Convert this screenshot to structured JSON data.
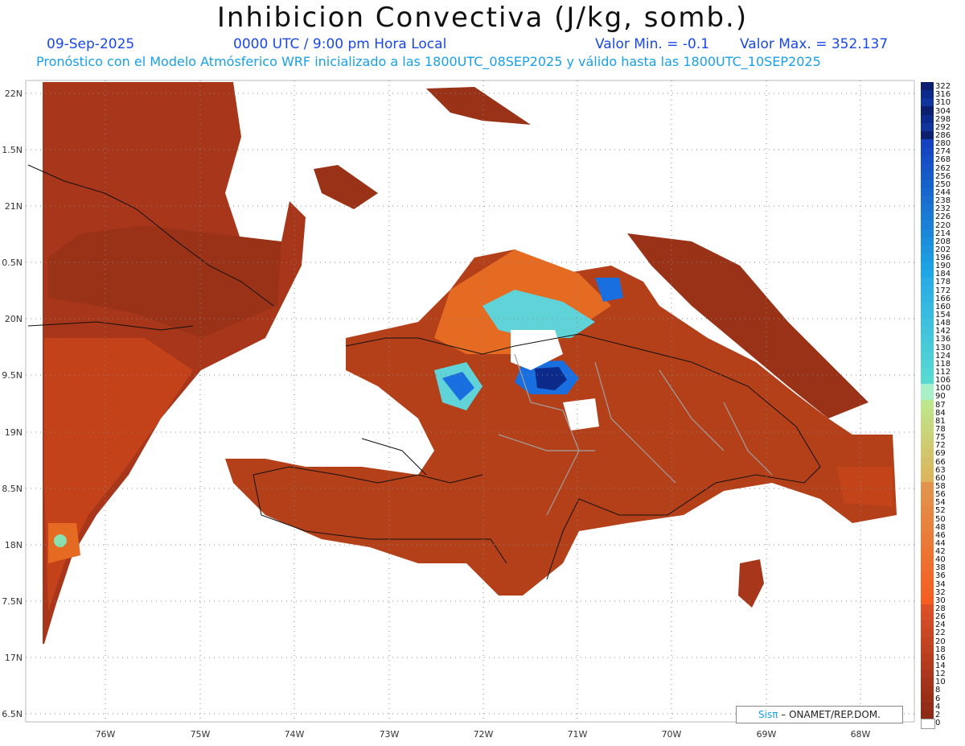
{
  "title": "Inhibicion Convectiva (J/kg, somb.)",
  "date": "09-Sep-2025",
  "time": "0000 UTC / 9:00 pm Hora Local",
  "min_label": "Valor Min. = -0.1",
  "max_label": "Valor Max. = 352.137",
  "subtitle": "Pronóstico con el Modelo Atmósferico WRF inicializado a las 1800UTC_08SEP2025 y válido hasta las  1800UTC_10SEP2025",
  "lat_labels": [
    "22N",
    "1.5N",
    "21N",
    "0.5N",
    "20N",
    "9.5N",
    "19N",
    "8.5N",
    "18N",
    "7.5N",
    "17N",
    "6.5N"
  ],
  "lon_labels": [
    "76W",
    "75W",
    "74W",
    "73W",
    "72W",
    "71W",
    "70W",
    "69W",
    "68W"
  ],
  "colorbar_labels": [
    "322",
    "316",
    "310",
    "304",
    "298",
    "292",
    "286",
    "280",
    "274",
    "268",
    "262",
    "256",
    "250",
    "244",
    "238",
    "232",
    "226",
    "220",
    "214",
    "208",
    "202",
    "196",
    "190",
    "184",
    "178",
    "172",
    "166",
    "160",
    "154",
    "148",
    "142",
    "136",
    "130",
    "124",
    "118",
    "112",
    "106",
    "100",
    "90",
    "87",
    "84",
    "81",
    "78",
    "75",
    "72",
    "69",
    "66",
    "63",
    "60",
    "58",
    "56",
    "54",
    "52",
    "50",
    "48",
    "46",
    "44",
    "42",
    "40",
    "38",
    "36",
    "34",
    "32",
    "30",
    "28",
    "26",
    "24",
    "22",
    "20",
    "18",
    "16",
    "14",
    "12",
    "10",
    "8",
    "6",
    "4",
    "2",
    "0"
  ],
  "credit": {
    "sis": "Sisπ",
    "rest": "– ONAMET/REP.DOM."
  },
  "colors": {
    "land_dark": "#8b2a14",
    "land_mid": "#c53c12",
    "land_orange": "#e8601a",
    "cyan": "#5fd3d8",
    "blue": "#1a6fe0",
    "navy": "#0b2a8a"
  }
}
